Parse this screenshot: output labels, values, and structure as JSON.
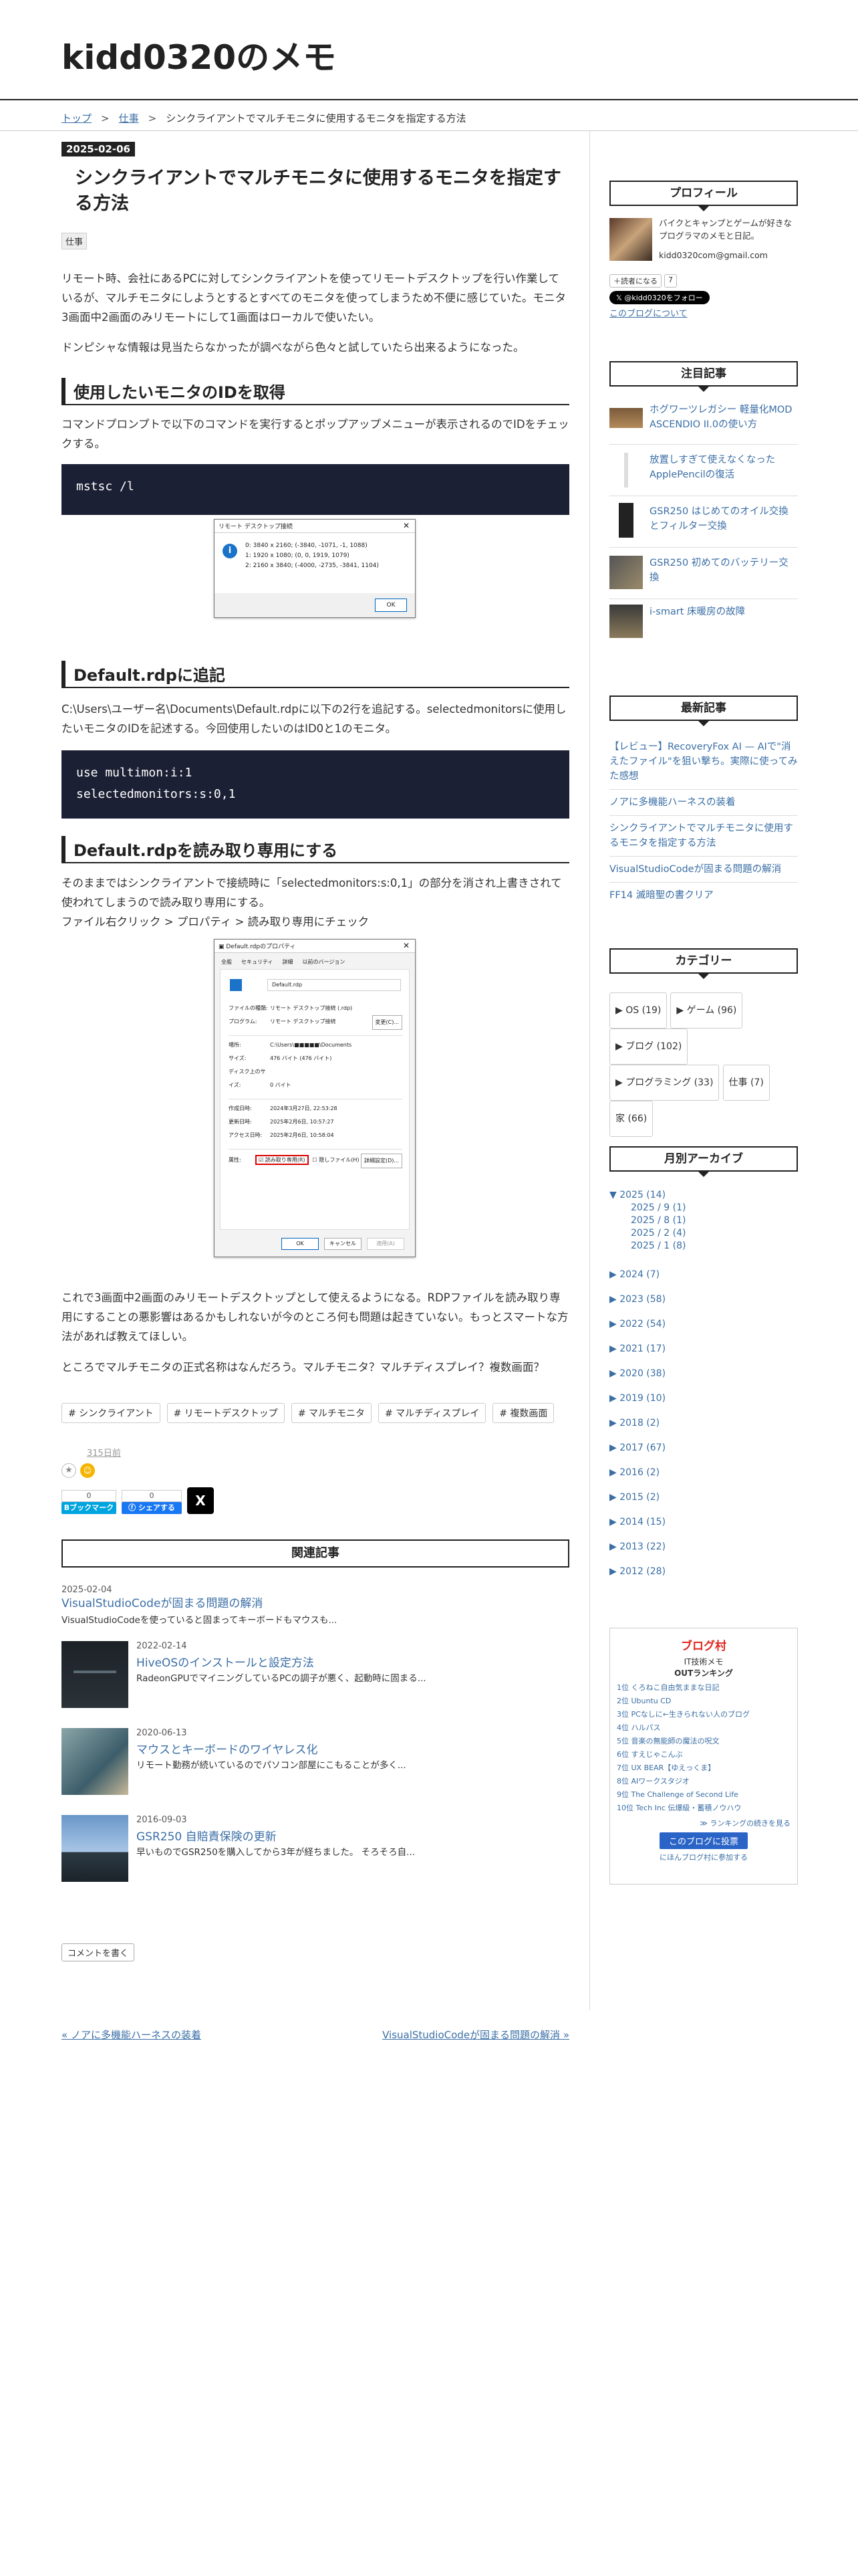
{
  "header": {
    "site_title": "kidd0320のメモ"
  },
  "breadcrumb": {
    "top": "トップ",
    "sep": ">",
    "cat": "仕事",
    "current": "シンクライアントでマルチモニタに使用するモニタを指定する方法"
  },
  "entry": {
    "date": "2025-02-06",
    "title": "シンクライアントでマルチモニタに使用するモニタを指定する方法",
    "category": "仕事",
    "p1": "リモート時、会社にあるPCに対してシンクライアントを使ってリモートデスクトップを行い作業しているが、マルチモニタにしようとするとすべてのモニタを使ってしまうため不便に感じていた。モニタ3画面中2画面のみリモートにして1画面はローカルで使いたい。",
    "p2": "ドンピシャな情報は見当たらなかったが調べながら色々と試していたら出来るようになった。",
    "h1": "使用したいモニタのIDを取得",
    "p3": "コマンドプロンプトで以下のコマンドを実行するとポップアップメニューが表示されるのでIDをチェックする。",
    "code1": "mstsc /l",
    "dlg1": {
      "title": "リモート デスクトップ接続",
      "lines": [
        "0: 3840 x 2160; (-3840, -1071, -1, 1088)",
        "1: 1920 x 1080; (0, 0, 1919, 1079)",
        "2: 2160 x 3840; (-4000, -2735, -3841, 1104)"
      ],
      "ok": "OK"
    },
    "h2": "Default.rdpに追記",
    "p4": "C:\\Users\\ユーザー名\\Documents\\Default.rdpに以下の2行を追記する。selectedmonitorsに使用したいモニタのIDを記述する。今回使用したいのはID0と1のモニタ。",
    "code2a": "use multimon:i:1",
    "code2b": "selectedmonitors:s:0,1",
    "h3": "Default.rdpを読み取り専用にする",
    "p5": "そのままではシンクライアントで接続時に「selectedmonitors:s:0,1」の部分を消され上書きされて使われてしまうので読み取り専用にする。",
    "p6": "ファイル右クリック > プロパティ > 読み取り専用にチェック",
    "dlg2": {
      "title": "Default.rdpのプロパティ",
      "tabs": [
        "全般",
        "セキュリティ",
        "詳細",
        "以前のバージョン"
      ],
      "filename": "Default.rdp",
      "rows": [
        {
          "k": "ファイルの種類:",
          "v": "リモート デスクトップ接続 (.rdp)"
        },
        {
          "k": "プログラム:",
          "v": "リモート デスクトップ接続"
        },
        {
          "k": "場所:",
          "v": "C:\\Users\\■■■■■\\Documents"
        },
        {
          "k": "サイズ:",
          "v": "476 バイト (476 バイト)"
        },
        {
          "k": "ディスク上のサイズ:",
          "v": "0 バイト"
        },
        {
          "k": "作成日時:",
          "v": "2024年3月27日, 22:53:28"
        },
        {
          "k": "更新日時:",
          "v": "2025年2月6日, 10:57:27"
        },
        {
          "k": "アクセス日時:",
          "v": "2025年2月6日, 10:58:04"
        }
      ],
      "change": "変更(C)...",
      "attr": "属性:",
      "ro": "読み取り専用(R)",
      "hidden": "隠しファイル(H)",
      "detail": "詳細設定(D)...",
      "ok": "OK",
      "cancel": "キャンセル",
      "apply": "適用(A)"
    },
    "p7": "これで3画面中2画面のみリモートデスクトップとして使えるようになる。RDPファイルを読み取り専用にすることの悪影響はあるかもしれないが今のところ何も問題は起きていない。もっとスマートな方法があれば教えてほしい。",
    "p8": "ところでマルチモニタの正式名称はなんだろう。マルチモニタ？マルチディスプレイ？複数画面？",
    "tags": [
      "# シンクライアント",
      "# リモートデスクトップ",
      "# マルチモニタ",
      "# マルチディスプレイ",
      "# 複数画面"
    ],
    "days_ago": "315日前",
    "hatena": {
      "count": "0",
      "label": "Bブックマーク"
    },
    "fb": {
      "count": "0",
      "label": "シェアする"
    },
    "x_label": "X"
  },
  "related": {
    "heading": "関連記事",
    "items": [
      {
        "date": "2025-02-04",
        "title": "VisualStudioCodeが固まる問題の解消",
        "desc": "VisualStudioCodeを使っていると固まってキーボードもマウスも..."
      },
      {
        "date": "2022-02-14",
        "title": "HiveOSのインストールと設定方法",
        "desc": "RadeonGPUでマイニングしているPCの調子が悪く、起動時に固まる..."
      },
      {
        "date": "2020-06-13",
        "title": "マウスとキーボードのワイヤレス化",
        "desc": "リモート勤務が続いているのでパソコン部屋にこもることが多く..."
      },
      {
        "date": "2016-09-03",
        "title": "GSR250 自賠責保険の更新",
        "desc": "早いものでGSR250を購入してから3年が経ちました。 そろそろ自..."
      }
    ]
  },
  "comment_button": "コメントを書く",
  "pager": {
    "prev": "« ノアに多機能ハーネスの装着",
    "next": "VisualStudioCodeが固まる問題の解消 »"
  },
  "sidebar": {
    "profile": {
      "heading": "プロフィール",
      "desc": "バイクとキャンプとゲームが好きなプログラマのメモと日記。",
      "email": "kidd0320com@gmail.com",
      "reader": "読者になる",
      "reader_count": "7",
      "follow": "@kidd0320をフォロー",
      "about": "このブログについて"
    },
    "featured": {
      "heading": "注目記事",
      "items": [
        "ホグワーツレガシー 軽量化MOD ASCENDIO II.0の使い方",
        "放置しすぎて使えなくなったApplePencilの復活",
        "GSR250 はじめてのオイル交換とフィルター交換",
        "GSR250 初めてのバッテリー交換",
        "i-smart 床暖房の故障"
      ]
    },
    "recent": {
      "heading": "最新記事",
      "items": [
        "【レビュー】RecoveryFox AI — AIで\"消えたファイル\"を狙い撃ち。実際に使ってみた感想",
        "ノアに多機能ハーネスの装着",
        "シンクライアントでマルチモニタに使用するモニタを指定する方法",
        "VisualStudioCodeが固まる問題の解消",
        "FF14 滅暗聖の書クリア"
      ]
    },
    "categories": {
      "heading": "カテゴリー",
      "items": [
        "▶ OS (19)",
        "▶ ゲーム (96)",
        "▶ ブログ (102)",
        "▶ プログラミング (33)",
        "仕事 (7)",
        "家 (66)"
      ]
    },
    "archive": {
      "heading": "月別アーカイブ",
      "open_year": "▼ 2025 (14)",
      "months": [
        "2025 / 9 (1)",
        "2025 / 8 (1)",
        "2025 / 2 (4)",
        "2025 / 1 (8)"
      ],
      "years": [
        "▶ 2024 (7)",
        "▶ 2023 (58)",
        "▶ 2022 (54)",
        "▶ 2021 (17)",
        "▶ 2020 (38)",
        "▶ 2019 (10)",
        "▶ 2018 (2)",
        "▶ 2017 (67)",
        "▶ 2016 (2)",
        "▶ 2015 (2)",
        "▶ 2014 (15)",
        "▶ 2013 (22)",
        "▶ 2012 (28)"
      ]
    },
    "blogmura": {
      "logo": "ブログ村",
      "title": "IT技術メモ",
      "subtitle": "OUTランキング",
      "ranks": [
        "1位 くろねこ自由気ままな日記",
        "2位 Ubuntu CD",
        "3位 PCなしに←生きられない人のブログ",
        "4位 ハルパス",
        "5位 音楽の無能師の魔法の呪文",
        "6位 すえじゃこんぶ",
        "7位 UX BEAR【ゆえっくま】",
        "8位 AIワークスタジオ",
        "9位 The Challenge of Second Life",
        "10位 Tech Inc 伝爆級・蓄積ノウハウ"
      ],
      "more": "≫ ランキングの続きを見る",
      "join": "このブログに投票",
      "join_sub": "にほんブログ村に参加する"
    }
  },
  "colors": {
    "accent": "#3a6ea5",
    "dark": "#222222",
    "code_bg": "#1c2034",
    "blogmura_btn": "#2b64c7"
  }
}
